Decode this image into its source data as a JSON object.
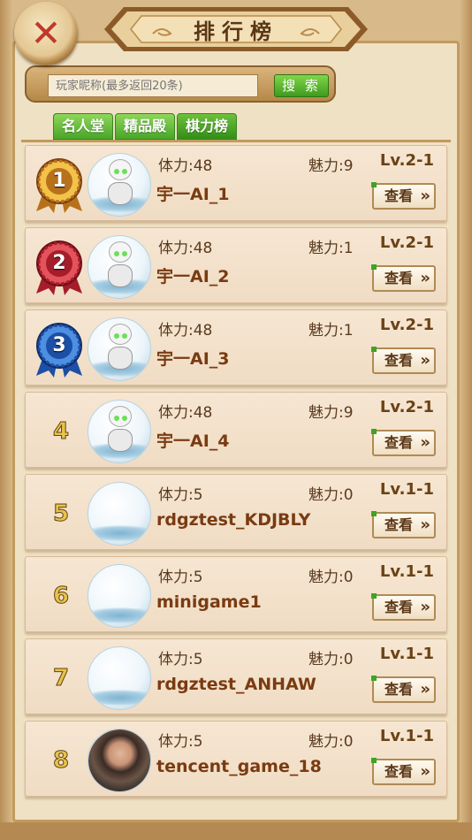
{
  "header": {
    "title": "排行榜",
    "close_icon": "close-x-icon"
  },
  "search": {
    "placeholder": "玩家昵称(最多返回20条)",
    "value": "",
    "button_label": "搜 索"
  },
  "tabs": [
    {
      "label": "名人堂",
      "active": false
    },
    {
      "label": "精品殿",
      "active": false
    },
    {
      "label": "棋力榜",
      "active": true
    }
  ],
  "colors": {
    "accent_green": "#48a628",
    "name_brown": "#7a3b12",
    "panel_bg": "#efe1c3"
  },
  "labels": {
    "stamina_prefix": "体力:",
    "charm_prefix": "魅力:",
    "view_button": "查看"
  },
  "rows": [
    {
      "rank": "1",
      "medal": "gold-medal-icon",
      "stamina": "体力:48",
      "charm": "魅力:9",
      "level": "Lv.2-1",
      "name": "宇一AI_1",
      "avatar": "robot"
    },
    {
      "rank": "2",
      "medal": "red-medal-icon",
      "stamina": "体力:48",
      "charm": "魅力:1",
      "level": "Lv.2-1",
      "name": "宇一AI_2",
      "avatar": "robot"
    },
    {
      "rank": "3",
      "medal": "blue-medal-icon",
      "stamina": "体力:48",
      "charm": "魅力:1",
      "level": "Lv.2-1",
      "name": "宇一AI_3",
      "avatar": "robot"
    },
    {
      "rank": "4",
      "medal": "",
      "stamina": "体力:48",
      "charm": "魅力:9",
      "level": "Lv.2-1",
      "name": "宇一AI_4",
      "avatar": "robot"
    },
    {
      "rank": "5",
      "medal": "",
      "stamina": "体力:5",
      "charm": "魅力:0",
      "level": "Lv.1-1",
      "name": "rdgztest_KDJBLY",
      "avatar": "empty"
    },
    {
      "rank": "6",
      "medal": "",
      "stamina": "体力:5",
      "charm": "魅力:0",
      "level": "Lv.1-1",
      "name": "minigame1",
      "avatar": "empty"
    },
    {
      "rank": "7",
      "medal": "",
      "stamina": "体力:5",
      "charm": "魅力:0",
      "level": "Lv.1-1",
      "name": "rdgztest_ANHAW",
      "avatar": "empty"
    },
    {
      "rank": "8",
      "medal": "",
      "stamina": "体力:5",
      "charm": "魅力:0",
      "level": "Lv.1-1",
      "name": "tencent_game_18",
      "avatar": "photo"
    }
  ]
}
